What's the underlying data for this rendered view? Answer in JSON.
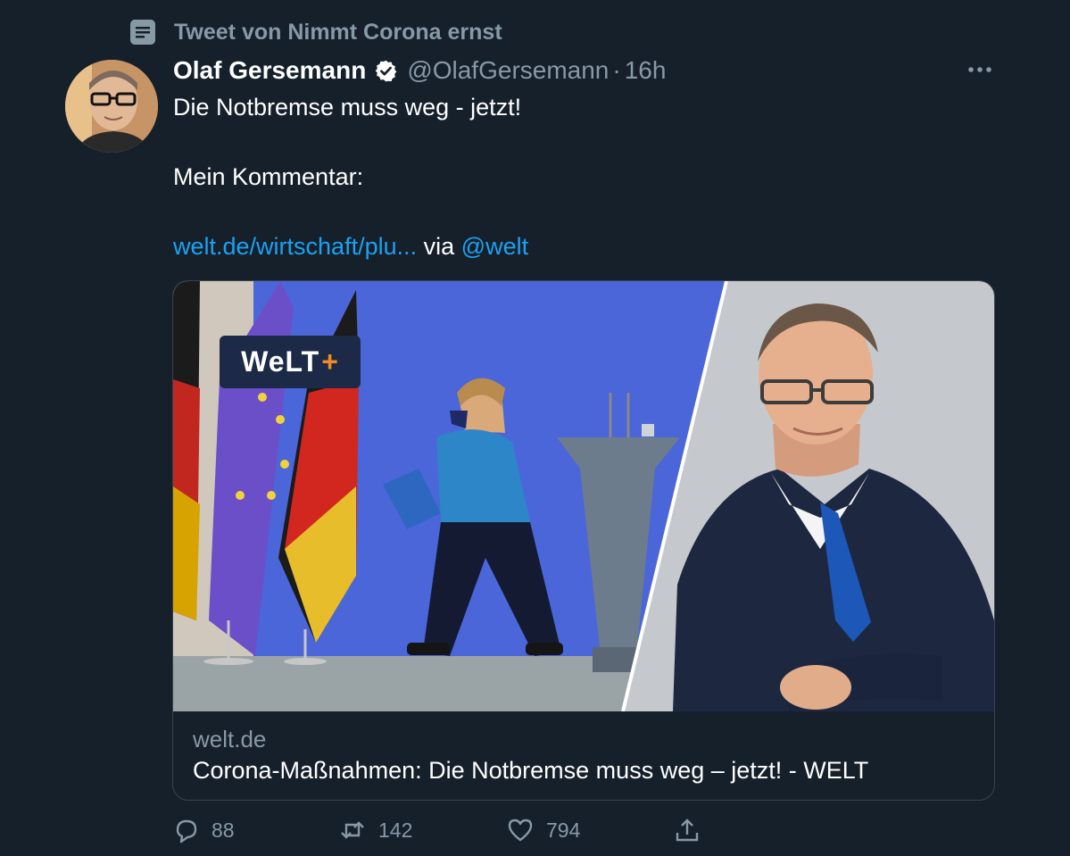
{
  "context": {
    "text": "Tweet von Nimmt Corona ernst",
    "icon": "document-icon"
  },
  "tweet": {
    "author_name": "Olaf Gersemann",
    "handle": "@OlafGersemann",
    "separator": "·",
    "time": "16h",
    "line1": "Die Notbremse muss weg - jetzt!",
    "line2": "Mein Kommentar:",
    "link_text": "welt.de/wirtschaft/plu...",
    "via": "via",
    "mention": "@welt"
  },
  "card": {
    "logo_text": "WeLT",
    "logo_plus": "+",
    "domain": "welt.de",
    "title": "Corona-Maßnahmen: Die Notbremse muss weg – jetzt! - WELT"
  },
  "actions": {
    "replies": "88",
    "retweets": "142",
    "likes": "794"
  },
  "colors": {
    "background": "#15202b",
    "link": "#1da1f2",
    "muted": "#8899a6",
    "border": "#38444d"
  }
}
